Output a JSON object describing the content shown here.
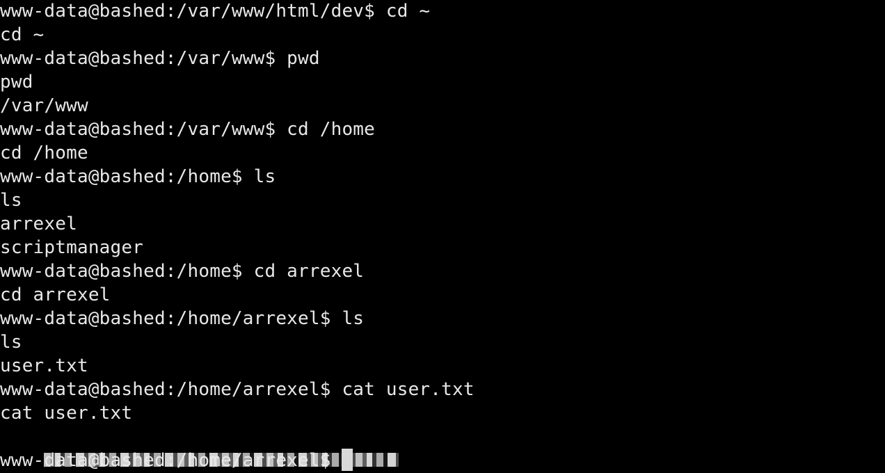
{
  "terminal": {
    "lines": [
      "www-data@bashed:/var/www/html/dev$ cd ~",
      "cd ~",
      "www-data@bashed:/var/www$ pwd",
      "pwd",
      "/var/www",
      "www-data@bashed:/var/www$ cd /home",
      "cd /home",
      "www-data@bashed:/home$ ls",
      "ls",
      "arrexel",
      "scriptmanager",
      "www-data@bashed:/home$ cd arrexel",
      "cd arrexel",
      "www-data@bashed:/home/arrexel$ ls",
      "ls",
      "user.txt",
      "www-data@bashed:/home/arrexel$ cat user.txt",
      "cat user.txt"
    ],
    "current_prompt": "www-data@bashed:/home/arrexel$ "
  },
  "colors": {
    "background": "#000000",
    "text": "#e8e8e8"
  }
}
